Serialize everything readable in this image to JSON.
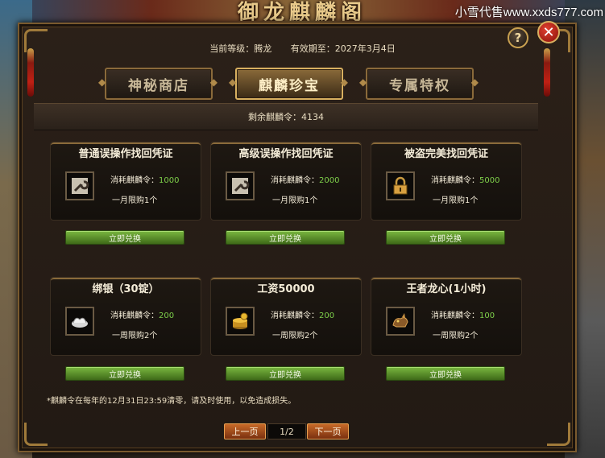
{
  "window": {
    "title": "御龙麒麟阁",
    "watermark": "小雪代售www.xxds777.com"
  },
  "info": {
    "level_label": "当前等级：腾龙",
    "expiry_label": "有效期至：2027年3月4日"
  },
  "tabs": [
    {
      "label": "神秘商店",
      "active": false
    },
    {
      "label": "麒麟珍宝",
      "active": true
    },
    {
      "label": "专属特权",
      "active": false
    }
  ],
  "remaining": "剩余麒麟令：4134",
  "items": [
    {
      "name": "普通误操作找回凭证",
      "cost_label": "消耗麒麟令：",
      "cost": "1000",
      "limit": "一月限购1个",
      "icon": "wrench-icon",
      "button": "立即兑换"
    },
    {
      "name": "高级误操作找回凭证",
      "cost_label": "消耗麒麟令：",
      "cost": "2000",
      "limit": "一月限购1个",
      "icon": "wrench-icon",
      "button": "立即兑换"
    },
    {
      "name": "被盗完美找回凭证",
      "cost_label": "消耗麒麟令：",
      "cost": "5000",
      "limit": "一月限购1个",
      "icon": "lock-icon",
      "button": "立即兑换"
    },
    {
      "name": "绑银（30锭）",
      "cost_label": "消耗麒麟令：",
      "cost": "200",
      "limit": "一周限购2个",
      "icon": "silver-ingot-icon",
      "button": "立即兑换"
    },
    {
      "name": "工资50000",
      "cost_label": "消耗麒麟令：",
      "cost": "200",
      "limit": "一周限购2个",
      "icon": "gold-coins-icon",
      "button": "立即兑换"
    },
    {
      "name": "王者龙心(1小时)",
      "cost_label": "消耗麒麟令：",
      "cost": "100",
      "limit": "一周限购2个",
      "icon": "dragon-heart-icon",
      "button": "立即兑换"
    }
  ],
  "notice": "*麒麟令在每年的12月31日23:59清零，请及时使用，以免造成损失。",
  "pager": {
    "prev": "上一页",
    "page": "1/2",
    "next": "下一页"
  },
  "controls": {
    "help": "?",
    "close": "✕"
  },
  "colors": {
    "cost_value": "#7ed04a",
    "button_green": "#5a9a2c",
    "pager_button": "#a04a1c",
    "frame_gold": "#a07a3a"
  }
}
